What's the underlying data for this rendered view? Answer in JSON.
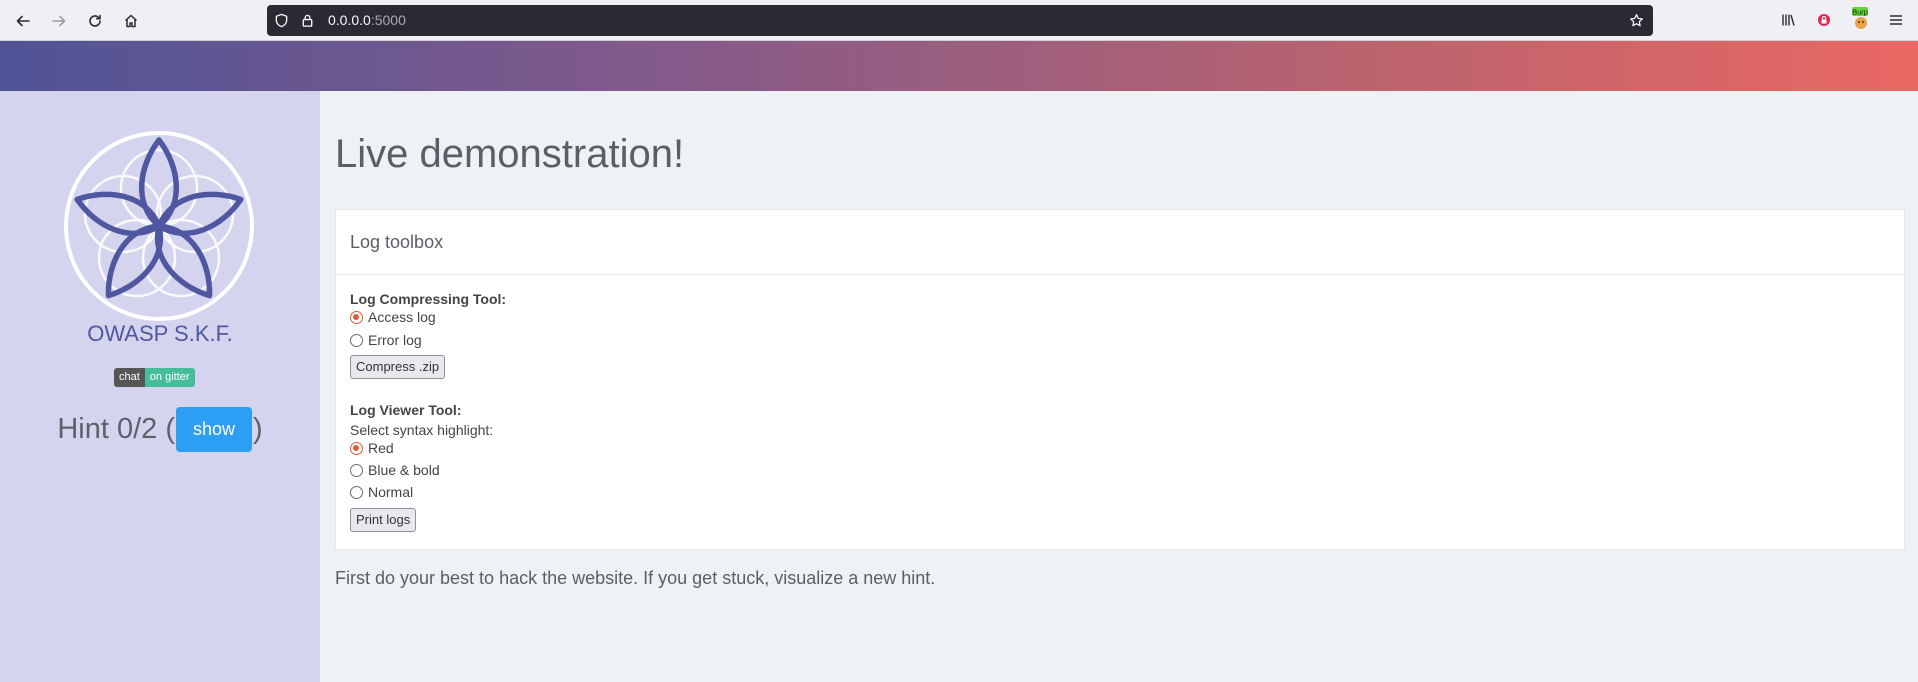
{
  "browser": {
    "url_host": "0.0.0.0",
    "url_port": ":5000",
    "icons": [
      "back-icon",
      "forward-icon",
      "reload-icon",
      "home-icon",
      "shield-icon",
      "lock-icon",
      "star-icon",
      "library-icon",
      "extension-icon",
      "burp-icon",
      "menu-icon"
    ],
    "burp_badge": "Burp"
  },
  "sidebar": {
    "brand": "OWASP S.K.F.",
    "gitter_left": "chat",
    "gitter_right": "on gitter",
    "hint_prefix": "Hint 0/2 (",
    "show_label": "show",
    "hint_suffix": ")"
  },
  "main": {
    "title": "Live demonstration!",
    "card_title": "Log toolbox",
    "compress": {
      "heading": "Log Compressing Tool:",
      "options": [
        {
          "label": "Access log",
          "checked": true
        },
        {
          "label": "Error log",
          "checked": false
        }
      ],
      "button": "Compress .zip"
    },
    "viewer": {
      "heading": "Log Viewer Tool:",
      "subheading": "Select syntax highlight:",
      "options": [
        {
          "label": "Red",
          "checked": true
        },
        {
          "label": "Blue & bold",
          "checked": false
        },
        {
          "label": "Normal",
          "checked": false
        }
      ],
      "button": "Print logs"
    },
    "footer": "First do your best to hack the website. If you get stuck, visualize a new hint."
  },
  "colors": {
    "gradient_start": "#4f5497",
    "gradient_end": "#ea6863",
    "sidebar_bg": "#d4d4ef",
    "accent_blue": "#2c9ff5",
    "radio_checked": "#e15b35"
  }
}
